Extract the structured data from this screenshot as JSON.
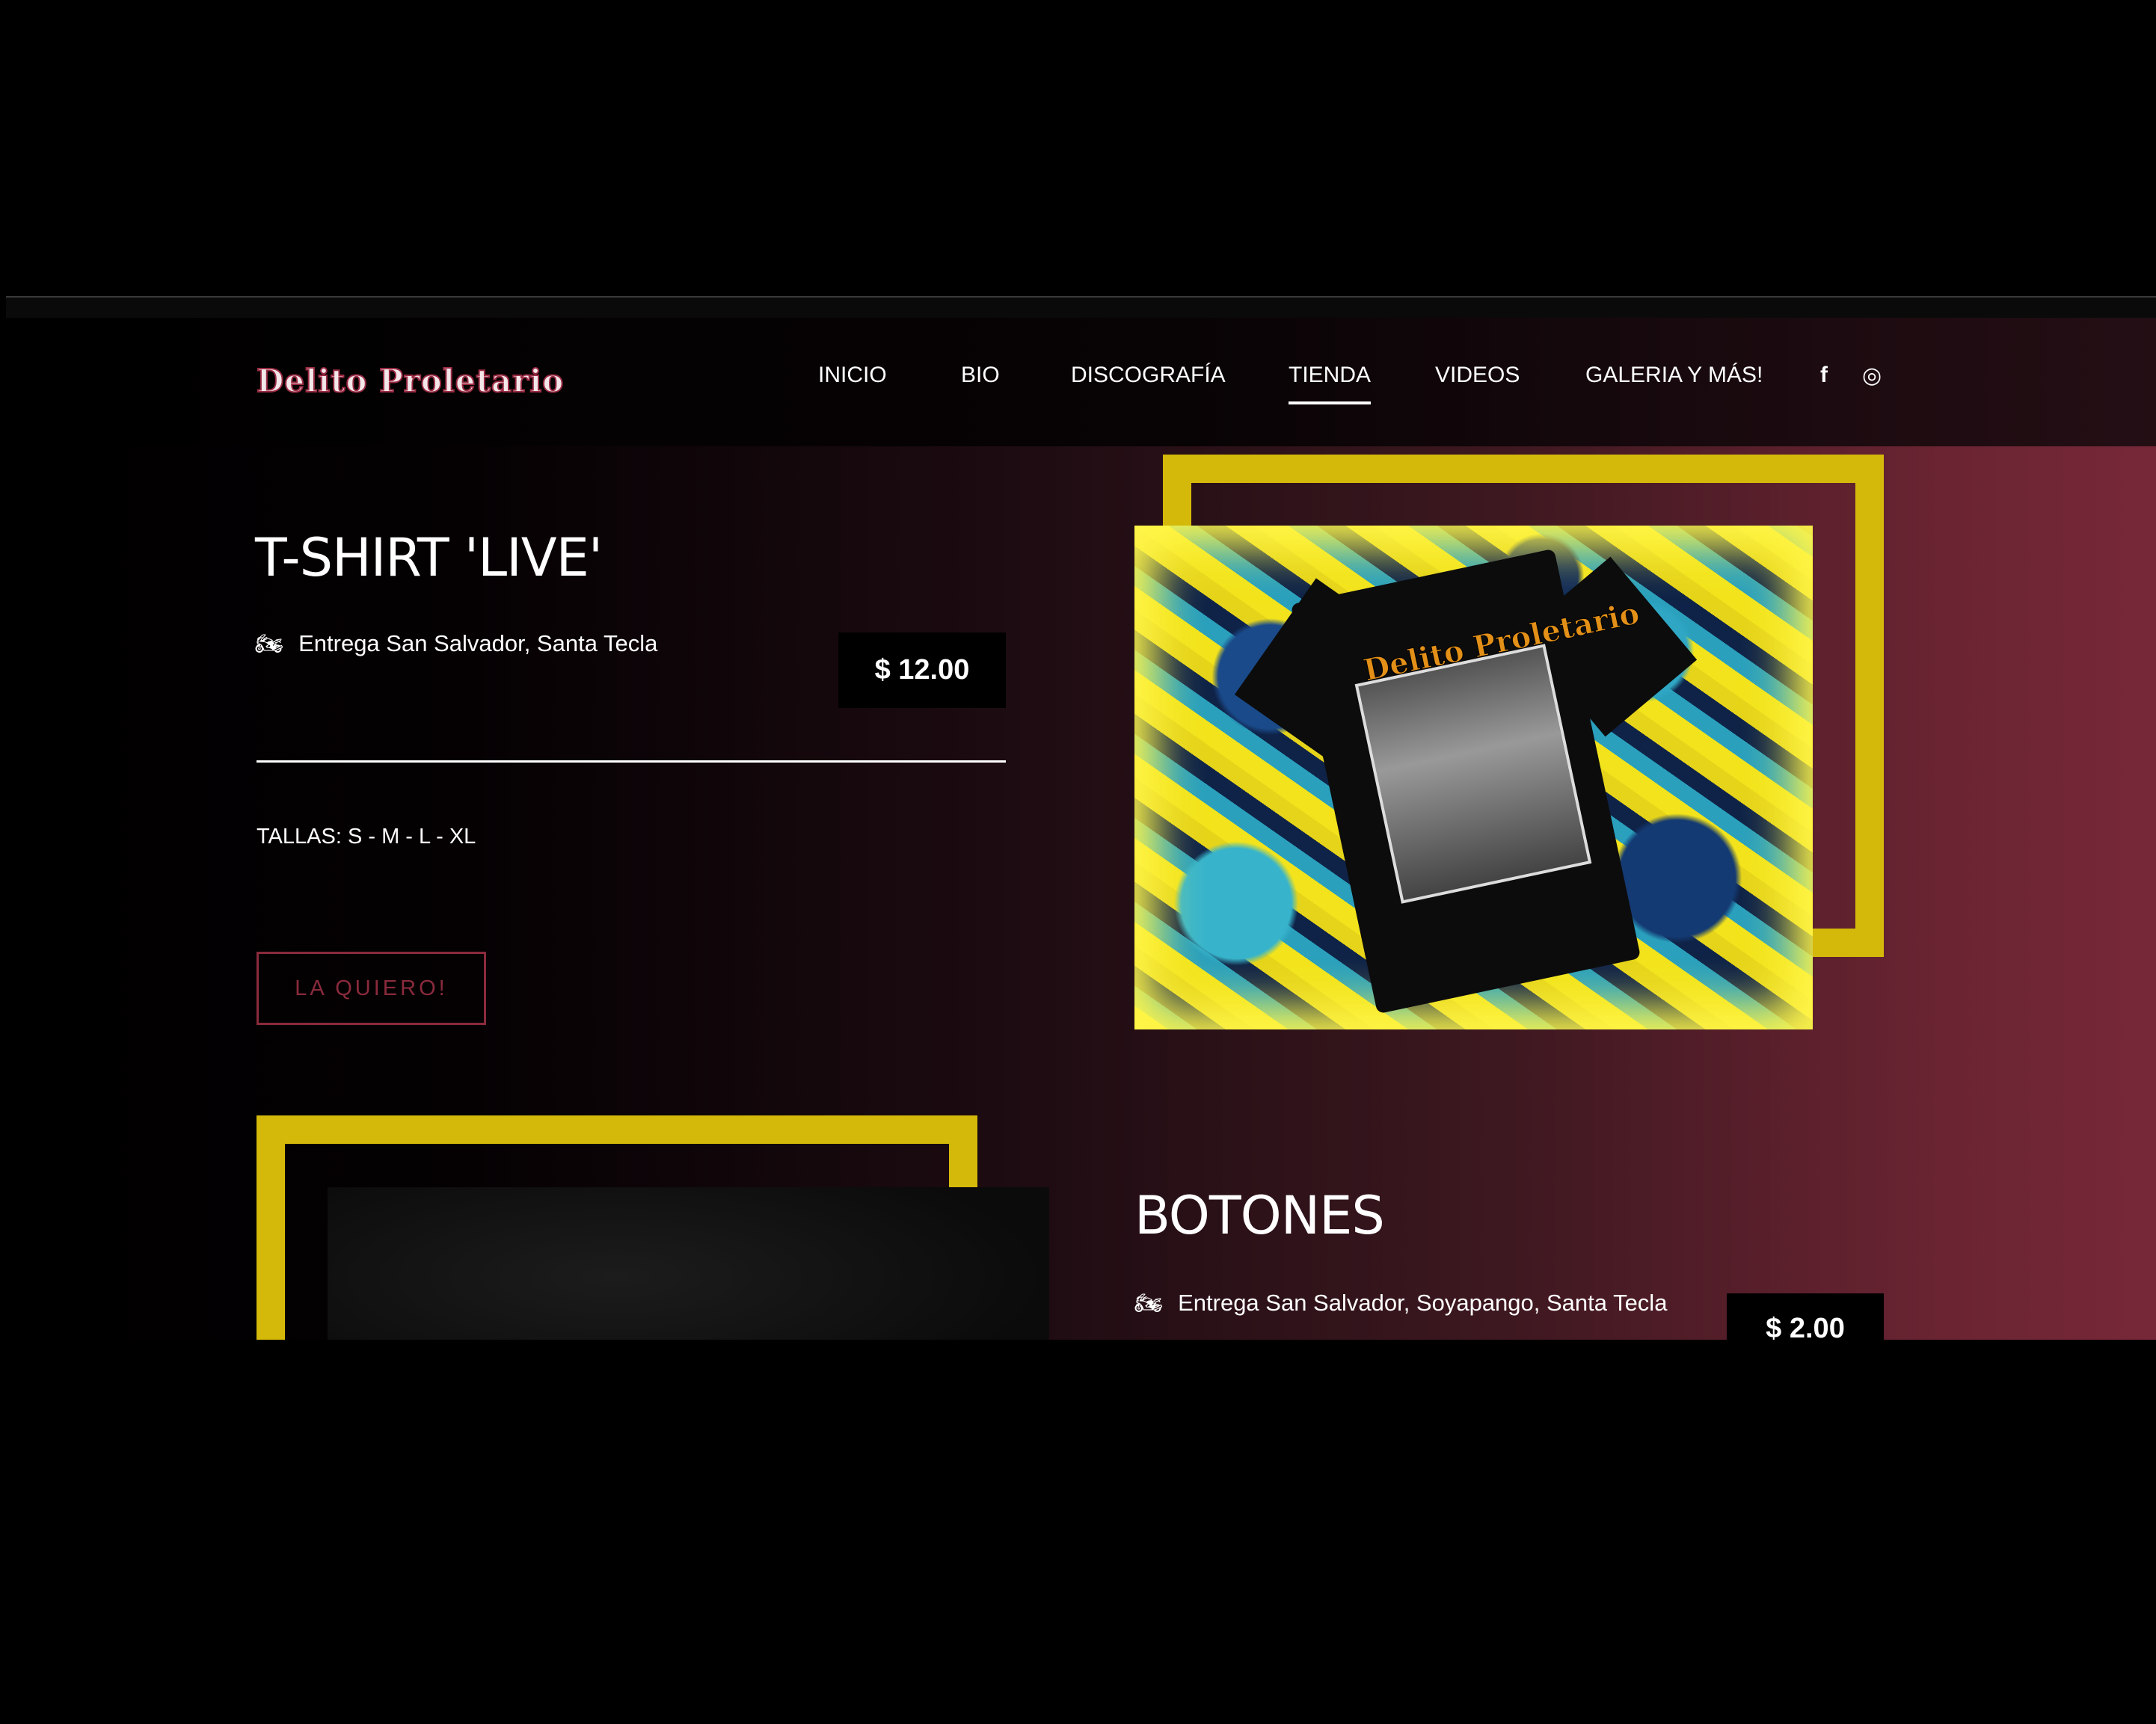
{
  "site": {
    "logo_text": "Delito Proletario",
    "nav": [
      {
        "label": "INICIO",
        "active": false
      },
      {
        "label": "BIO",
        "active": false
      },
      {
        "label": "DISCOGRAFÍA",
        "active": false
      },
      {
        "label": "TIENDA",
        "active": true
      },
      {
        "label": "VIDEOS",
        "active": false
      },
      {
        "label": "GALERIA Y MÁS!",
        "active": false
      }
    ],
    "social": {
      "facebook_icon": "f",
      "instagram_icon": "◎"
    }
  },
  "products": [
    {
      "title": "T-SHIRT 'LIVE'",
      "delivery": "Entrega San Salvador, Santa Tecla",
      "price": "$ 12.00",
      "sizes": "TALLAS: S - M - L - XL",
      "cta": "LA QUIERO!",
      "image_logo": "Delito Proletario"
    },
    {
      "title": "BOTONES",
      "delivery": "Entrega San Salvador, Soyapango, Santa Tecla",
      "price": "$ 2.00"
    }
  ],
  "colors": {
    "accent_frame": "#d4b90a",
    "brand": "#8a2a3c"
  }
}
